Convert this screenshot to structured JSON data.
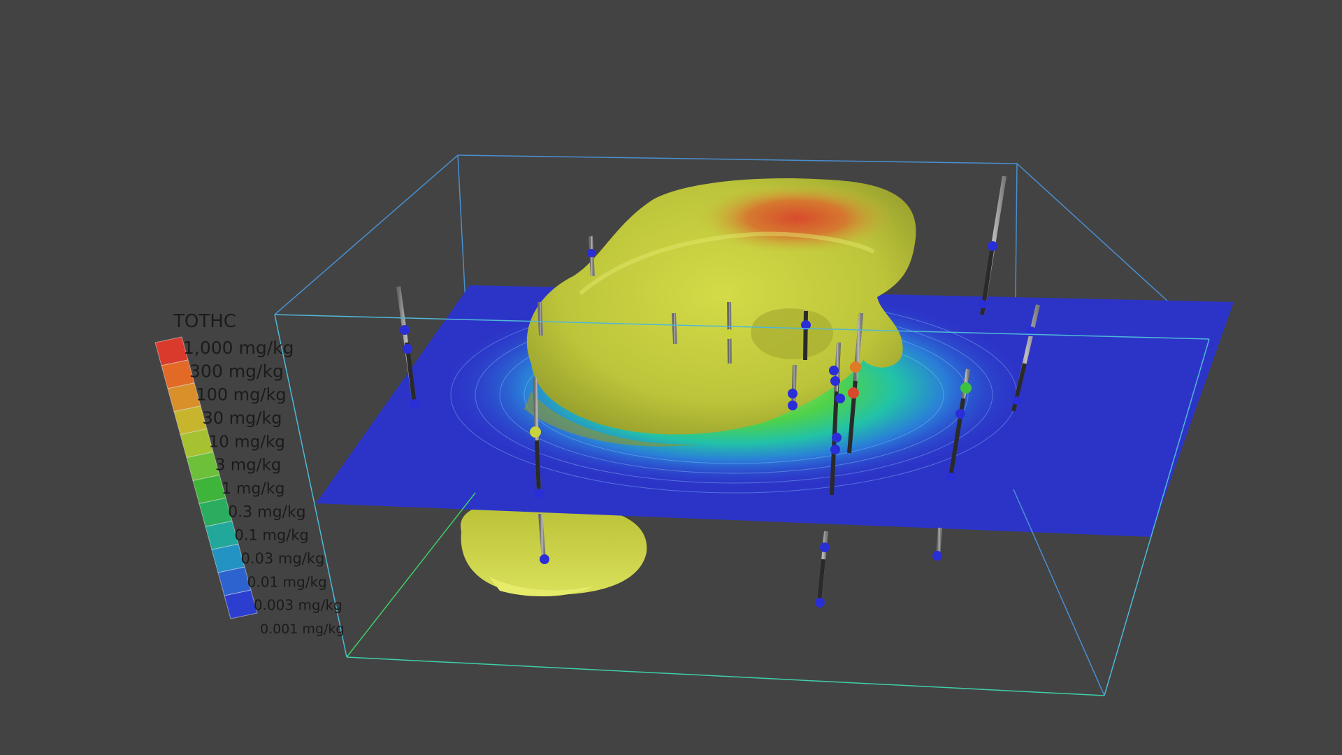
{
  "legend": {
    "title": "TOTHC",
    "labels": [
      "1,000 mg/kg",
      "300 mg/kg",
      "100 mg/kg",
      "30 mg/kg",
      "10 mg/kg",
      "3 mg/kg",
      "1 mg/kg",
      "0.3 mg/kg",
      "0.1 mg/kg",
      "0.03 mg/kg",
      "0.01 mg/kg",
      "0.003 mg/kg",
      "0.001 mg/kg"
    ],
    "colors": [
      "#d93a2b",
      "#e26a26",
      "#d98f2a",
      "#c7b52e",
      "#a6c230",
      "#6cc03a",
      "#3fb43a",
      "#2aad5f",
      "#22a89a",
      "#2393c4",
      "#2d63cf",
      "#2c3ecf"
    ]
  },
  "colors": {
    "background": "#434343",
    "plume": "#c4cc3a",
    "plume_hot": "#d9542c",
    "plane": "#2c34c8",
    "box": "#4fa6d8",
    "sample_low": "#2a2ed6",
    "sample_mid": "#c8d43a",
    "sample_high": "#e07a24",
    "sample_max": "#d9482a",
    "sample_green": "#3fc23f"
  }
}
